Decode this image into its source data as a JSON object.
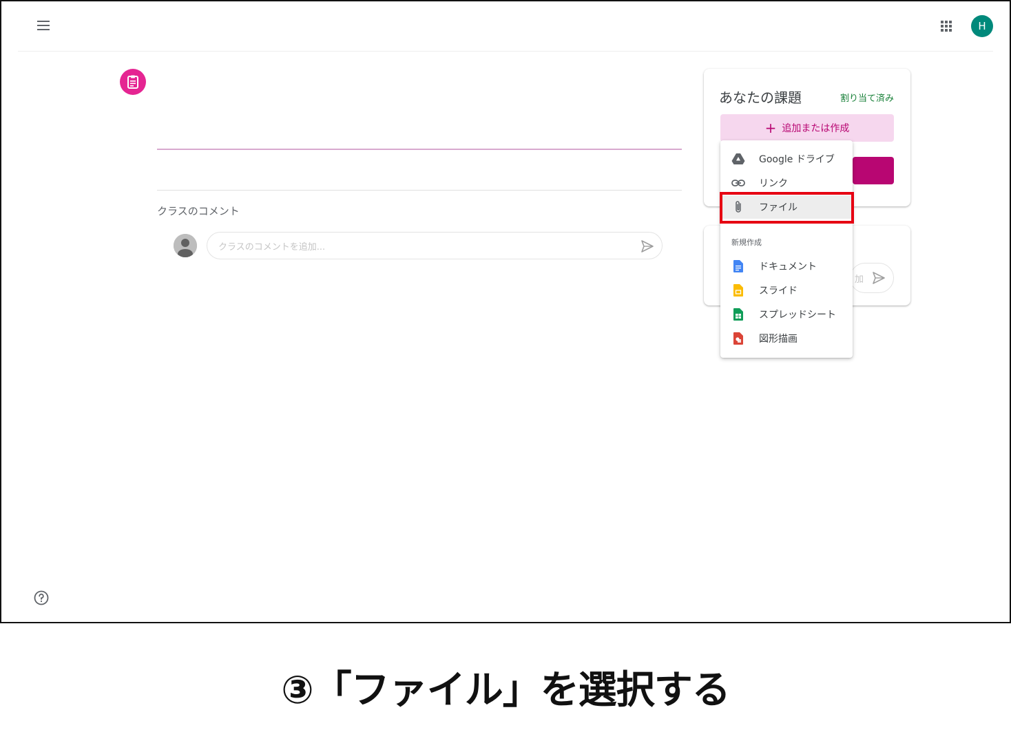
{
  "header": {
    "menu_icon": "hamburger-menu-icon",
    "apps_icon": "google-apps-grid-icon",
    "avatar_initial": "H",
    "avatar_color": "#00897b"
  },
  "assignment": {
    "icon": "assignment-clipboard-icon",
    "icon_color": "#e52592",
    "accent_line_color": "#d8a8cf"
  },
  "comments": {
    "heading": "クラスのコメント",
    "placeholder": "クラスのコメントを追加...",
    "send_icon": "send-icon"
  },
  "your_work": {
    "title": "あなたの課題",
    "status": "割り当て済み",
    "status_color": "#188038",
    "add_button_label": "追加または作成",
    "accent_color": "#b80672"
  },
  "private_comment": {
    "placeholder_fragment": "加"
  },
  "add_menu": {
    "items": [
      {
        "label": "Google ドライブ",
        "icon": "google-drive-icon"
      },
      {
        "label": "リンク",
        "icon": "link-icon"
      },
      {
        "label": "ファイル",
        "icon": "paperclip-icon"
      }
    ],
    "create_section": "新規作成",
    "create_items": [
      {
        "label": "ドキュメント",
        "icon": "google-docs-icon",
        "color": "#4285f4"
      },
      {
        "label": "スライド",
        "icon": "google-slides-icon",
        "color": "#fbbc04"
      },
      {
        "label": "スプレッドシート",
        "icon": "google-sheets-icon",
        "color": "#0f9d58"
      },
      {
        "label": "図形描画",
        "icon": "google-drawings-icon",
        "color": "#db4437"
      }
    ],
    "highlight_color": "#e60012"
  },
  "help_icon": "help-circle-icon",
  "caption": "③「ファイル」を選択する"
}
